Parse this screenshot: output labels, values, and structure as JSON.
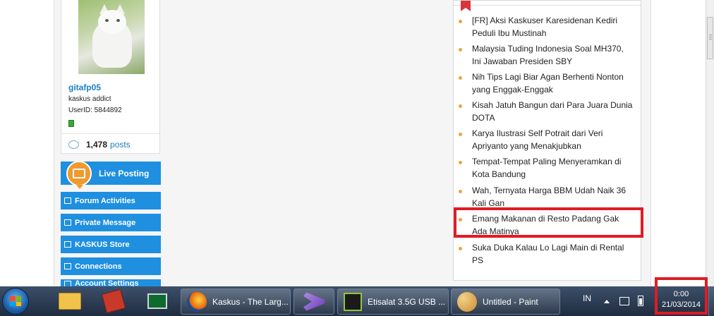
{
  "profile": {
    "username": "gitafp05",
    "rank": "kaskus addict",
    "user_id": "UserID: 5844892",
    "posts_count": "1,478",
    "posts_label": "posts"
  },
  "side_menu": {
    "live_posting": "Live Posting",
    "forum_activities": "Forum Activities",
    "private_message": "Private Message",
    "kaskus_store": "KASKUS Store",
    "connections": "Connections",
    "account_settings": "Account Settings"
  },
  "hot_threads": [
    {
      "title": "[FR] Aksi Kaskuser Karesidenan Kediri Peduli Ibu Mustinah"
    },
    {
      "title": "Malaysia Tuding Indonesia Soal MH370, Ini Jawaban Presiden SBY"
    },
    {
      "title": "Nih Tips Lagi Biar Agan Berhenti Nonton yang Enggak-Enggak"
    },
    {
      "title": "Kisah Jatuh Bangun dari Para Juara Dunia DOTA"
    },
    {
      "title": "Karya Ilustrasi Self Potrait dari Veri Apriyanto yang Menakjubkan"
    },
    {
      "title": "Tempat-Tempat Paling Menyeramkan di Kota Bandung"
    },
    {
      "title": "Wah, Ternyata Harga BBM Udah Naik 36 Kali Gan"
    },
    {
      "title": "Emang Makanan di Resto Padang Gak Ada Matinya"
    },
    {
      "title": "Suka Duka Kalau Lo Lagi Main di Rental PS"
    }
  ],
  "taskbar": {
    "firefox": "Kaskus - The Larg...",
    "etisalat": "Etisalat 3.5G USB ...",
    "paint": "Untitled - Paint",
    "language": "IN",
    "time": "0:00",
    "date": "21/03/2014"
  },
  "colors": {
    "accent_blue": "#1f8fe0",
    "link_blue": "#1a7fc2",
    "highlight_red": "#e01b24",
    "bullet_orange": "#f0a23e"
  }
}
